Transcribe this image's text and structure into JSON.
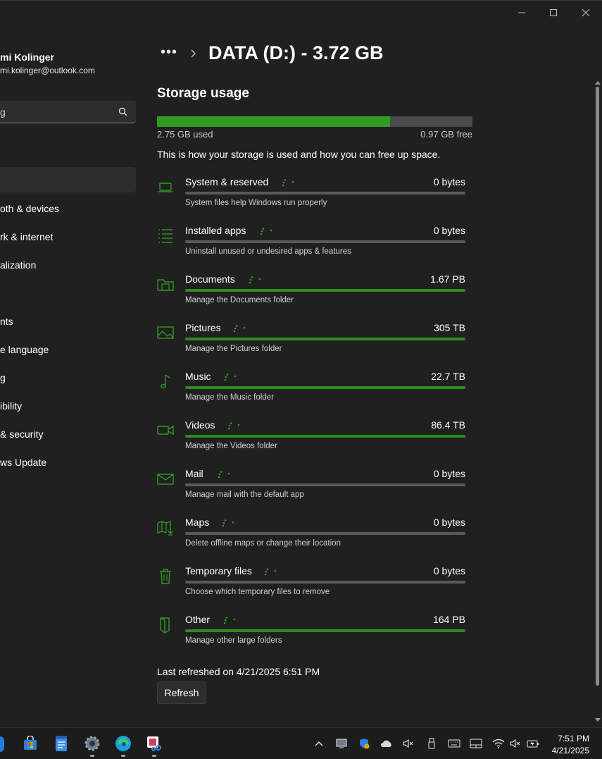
{
  "window": {
    "caption_icons": [
      "minimize-icon",
      "maximize-icon",
      "close-icon"
    ]
  },
  "sidebar": {
    "user_name": "mi Kolinger",
    "user_email": "mi.kolinger@outlook.com",
    "search_value": "g",
    "items": [
      {
        "label": ""
      },
      {
        "label": "oth & devices"
      },
      {
        "label": "rk & internet"
      },
      {
        "label": "alization"
      },
      {
        "label": ""
      },
      {
        "label": "nts"
      },
      {
        "label": "e language"
      },
      {
        "label": "g"
      },
      {
        "label": "ibility"
      },
      {
        "label": "& security"
      },
      {
        "label": "ws Update"
      }
    ]
  },
  "header": {
    "breadcrumb_more": "•••",
    "title": "DATA (D:) - 3.72 GB"
  },
  "storage": {
    "section_title": "Storage usage",
    "used_label": "2.75 GB used",
    "free_label": "0.97 GB free",
    "used_fraction": 0.739,
    "description": "This is how your storage is used and how you can free up space.",
    "accent_color": "#2f9b22",
    "categories": [
      {
        "name": "System & reserved",
        "size": "0 bytes",
        "sub": "System files help Windows run properly",
        "icon": "laptop-icon",
        "fill": 0
      },
      {
        "name": "Installed apps",
        "size": "0 bytes",
        "sub": "Uninstall unused or undesired apps & features",
        "icon": "apps-list-icon",
        "fill": 0
      },
      {
        "name": "Documents",
        "size": "1.67 PB",
        "sub": "Manage the Documents folder",
        "icon": "documents-folder-icon",
        "fill": 1
      },
      {
        "name": "Pictures",
        "size": "305 TB",
        "sub": "Manage the Pictures folder",
        "icon": "picture-icon",
        "fill": 1
      },
      {
        "name": "Music",
        "size": "22.7 TB",
        "sub": "Manage the Music folder",
        "icon": "music-note-icon",
        "fill": 1
      },
      {
        "name": "Videos",
        "size": "86.4 TB",
        "sub": "Manage the Videos folder",
        "icon": "video-camera-icon",
        "fill": 1
      },
      {
        "name": "Mail",
        "size": "0 bytes",
        "sub": "Manage mail with the default app",
        "icon": "mail-icon",
        "fill": 0
      },
      {
        "name": "Maps",
        "size": "0 bytes",
        "sub": "Delete offline maps or change their location",
        "icon": "map-icon",
        "fill": 0
      },
      {
        "name": "Temporary files",
        "size": "0 bytes",
        "sub": "Choose which temporary files to remove",
        "icon": "trash-icon",
        "fill": 0
      },
      {
        "name": "Other",
        "size": "164 PB",
        "sub": "Manage other large folders",
        "icon": "other-folder-icon",
        "fill": 1
      }
    ],
    "last_refreshed": "Last refreshed on 4/21/2025 6:51 PM",
    "refresh_label": "Refresh"
  },
  "taskbar": {
    "apps": [
      "store-icon",
      "notepad-icon",
      "settings-icon",
      "edge-icon",
      "snipping-tool-icon"
    ],
    "tray_icons": [
      "chevron-up-icon",
      "screen-icon",
      "defender-icon",
      "onedrive-icon",
      "mute-icon",
      "usb-icon",
      "keyboard-icon",
      "touchpad-icon",
      "wifi-icon",
      "volume-muted-icon",
      "battery-charging-icon"
    ],
    "time": "7:51 PM",
    "date": "4/21/2025"
  }
}
